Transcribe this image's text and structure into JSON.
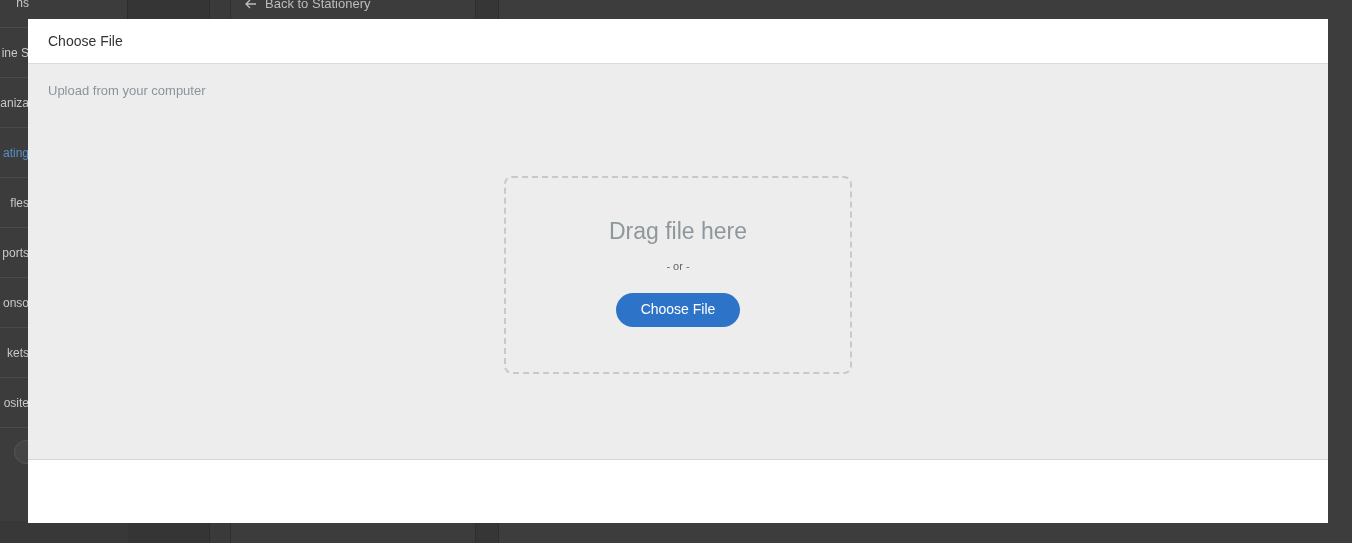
{
  "sidebar": {
    "items": [
      {
        "label": "ns",
        "selected": false
      },
      {
        "label": "ine S",
        "selected": false
      },
      {
        "label": "aniza",
        "selected": false
      },
      {
        "label": "ating",
        "selected": true
      },
      {
        "label": "fles",
        "selected": false
      },
      {
        "label": "ports",
        "selected": false
      },
      {
        "label": "onso",
        "selected": false
      },
      {
        "label": "kets",
        "selected": false
      },
      {
        "label": "osite",
        "selected": false
      }
    ]
  },
  "back_link": "Back to Stationery",
  "dialog": {
    "title": "Choose File",
    "section": "Upload from your computer",
    "drop_text": "Drag file here",
    "separator": "- or -",
    "button": "Choose File"
  }
}
